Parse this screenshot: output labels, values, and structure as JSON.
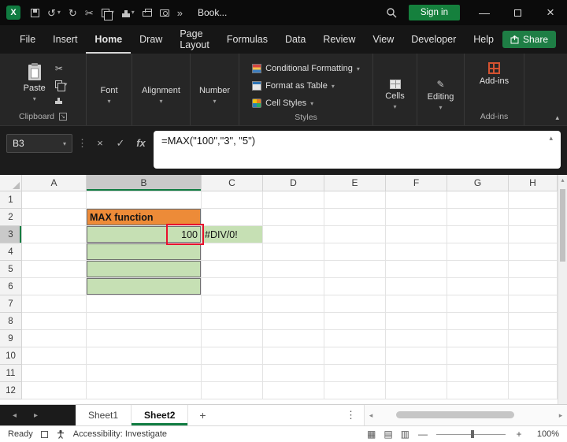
{
  "icons": {
    "excel_logo": "X",
    "chevron_down": "▾",
    "chevron_up": "▴",
    "arrow_left": "◂",
    "arrow_right": "▸",
    "undo": "↺",
    "redo": "↻",
    "cut": "✂",
    "more_commands": "»",
    "vertical_dots": "⋮",
    "cancel": "×",
    "enter": "✓",
    "minimize": "—",
    "close": "×",
    "launcher_arrow": "↘",
    "normal_view": "▦",
    "page_layout_view": "▤",
    "page_break_view": "▥",
    "zoom_out": "—",
    "zoom_in": "+",
    "pencil": "✎",
    "add": "+"
  },
  "colors": {
    "accent_green": "#107C41",
    "share_green": "#1E7E45",
    "cell_green": "#C6E0B4",
    "cell_orange": "#ED8B38",
    "annotation_red": "#E8112D"
  },
  "titlebar": {
    "document_name": "Book...",
    "sign_in_label": "Sign in"
  },
  "menu": {
    "items": [
      "File",
      "Insert",
      "Home",
      "Draw",
      "Page Layout",
      "Formulas",
      "Data",
      "Review",
      "View",
      "Developer",
      "Help"
    ],
    "active": "Home",
    "share_label": "Share"
  },
  "ribbon": {
    "paste_label": "Paste",
    "font_label": "Font",
    "alignment_label": "Alignment",
    "number_label": "Number",
    "styles_items": [
      "Conditional Formatting",
      "Format as Table",
      "Cell Styles"
    ],
    "cells_label": "Cells",
    "editing_label": "Editing",
    "addins_label": "Add-ins",
    "group_labels": {
      "clipboard": "Clipboard",
      "styles": "Styles",
      "addins": "Add-ins"
    }
  },
  "formula_bar": {
    "name_box": "B3",
    "fx_label": "fx",
    "formula": "=MAX(\"100\",\"3\", \"5\")"
  },
  "grid": {
    "columns": [
      "A",
      "B",
      "C",
      "D",
      "E",
      "F",
      "G",
      "H"
    ],
    "rows": [
      "1",
      "2",
      "3",
      "4",
      "5",
      "6",
      "7",
      "8",
      "9",
      "10",
      "11",
      "12"
    ],
    "selected": {
      "column": "B",
      "row": "3"
    },
    "cells": {
      "B2": {
        "text": "MAX function",
        "bold": true,
        "bg": "#ED8B38",
        "bordered": true,
        "align": "left"
      },
      "B3": {
        "text": "100",
        "bg": "#C6E0B4",
        "bordered": true,
        "align": "right",
        "annotated": true
      },
      "C3": {
        "text": "#DIV/0!",
        "bg": "#C6E0B4",
        "align": "left"
      },
      "B4": {
        "bg": "#C6E0B4",
        "bordered": true
      },
      "B5": {
        "bg": "#C6E0B4",
        "bordered": true
      },
      "B6": {
        "bg": "#C6E0B4",
        "bordered": true
      }
    }
  },
  "sheet_tabs": {
    "tabs": [
      "Sheet1",
      "Sheet2"
    ],
    "active": "Sheet2"
  },
  "status_bar": {
    "ready": "Ready",
    "accessibility": "Accessibility: Investigate",
    "zoom": "100%"
  }
}
